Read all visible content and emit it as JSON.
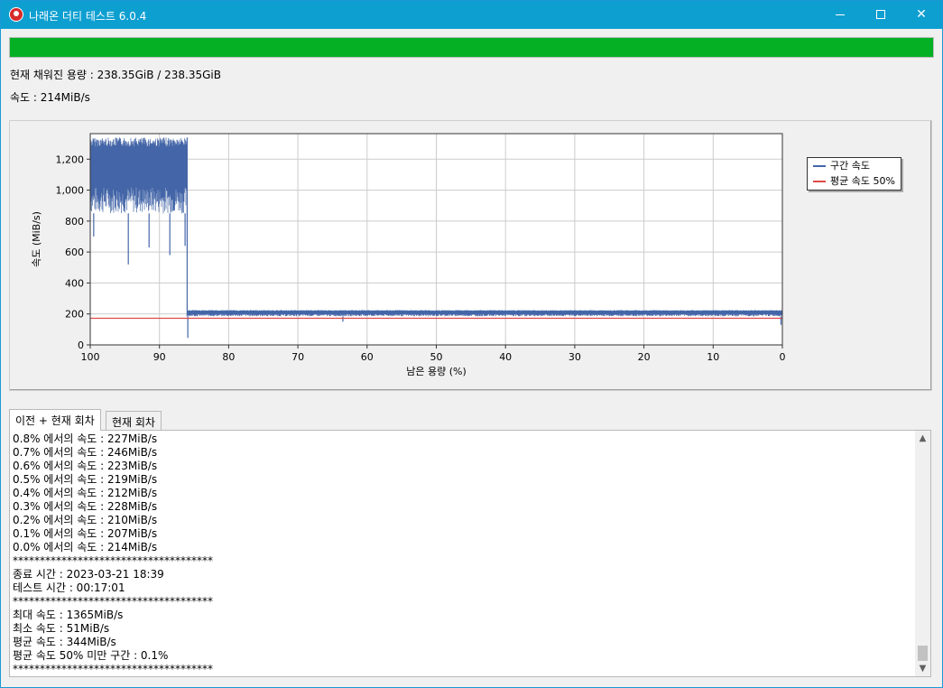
{
  "window": {
    "title": "나래온 더티 테스트 6.0.4",
    "colors": {
      "titlebar": "#0e9fd1",
      "progress": "#06b025"
    }
  },
  "progress": {
    "fraction": 1.0
  },
  "info": {
    "capacity": "현재 채워진 용량 : 238.35GiB / 238.35GiB",
    "speed": "속도 : 214MiB/s"
  },
  "chart_data": {
    "type": "line",
    "xlabel": "남은 용량 (%)",
    "ylabel": "속도 (MiB/s)",
    "xlim": [
      100,
      0
    ],
    "ylim": [
      0,
      1365
    ],
    "x_ticks": [
      100,
      90,
      80,
      70,
      60,
      50,
      40,
      30,
      20,
      10,
      0
    ],
    "y_ticks": [
      0,
      200,
      400,
      600,
      800,
      1000,
      1200
    ],
    "y_tick_labels": [
      "0",
      "200",
      "400",
      "600",
      "800",
      "1,000",
      "1,200"
    ],
    "grid": true,
    "legend": "right",
    "series": [
      {
        "name": "구간 속도",
        "color": "#4466a8",
        "segments": [
          {
            "x_from": 100,
            "x_to": 86,
            "band_low": 850,
            "band_high": 1340,
            "dips": [
              [
                99.5,
                700
              ],
              [
                94.5,
                520
              ],
              [
                91.5,
                630
              ],
              [
                88.5,
                580
              ],
              [
                86.3,
                640
              ]
            ]
          },
          {
            "x_from": 86,
            "x_to": 0,
            "band_low": 185,
            "band_high": 225,
            "dips": [
              [
                85.9,
                45
              ],
              [
                63.5,
                150
              ],
              [
                0.2,
                130
              ]
            ]
          }
        ]
      },
      {
        "name": "평균 속도 50%",
        "color": "#e04848",
        "values": [
          [
            100,
            172
          ],
          [
            0,
            172
          ]
        ]
      }
    ]
  },
  "tabs": [
    {
      "label": "이전 + 현재 회차",
      "active": true
    },
    {
      "label": "현재 회차",
      "active": false
    }
  ],
  "log": {
    "lines": [
      "0.8% 에서의 속도 : 227MiB/s",
      "0.7% 에서의 속도 : 246MiB/s",
      "0.6% 에서의 속도 : 223MiB/s",
      "0.5% 에서의 속도 : 219MiB/s",
      "0.4% 에서의 속도 : 212MiB/s",
      "0.3% 에서의 속도 : 228MiB/s",
      "0.2% 에서의 속도 : 210MiB/s",
      "0.1% 에서의 속도 : 207MiB/s",
      "0.0% 에서의 속도 : 214MiB/s",
      "*************************************",
      "종료 시간 : 2023-03-21 18:39",
      "테스트 시간 : 00:17:01",
      "*************************************",
      "최대 속도 : 1365MiB/s",
      "최소 속도 : 51MiB/s",
      "평균 속도 : 344MiB/s",
      "평균 속도 50% 미만 구간 : 0.1%",
      "*************************************"
    ]
  }
}
